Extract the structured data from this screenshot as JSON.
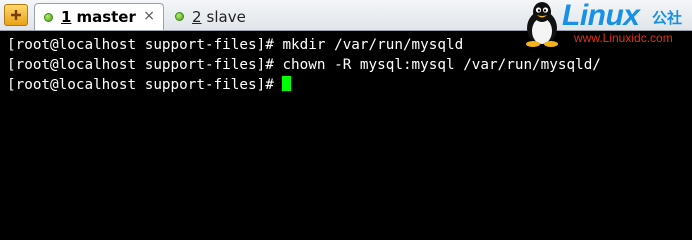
{
  "tabs": [
    {
      "number": "1",
      "title": "master",
      "close": "×",
      "active": true
    },
    {
      "number": "2",
      "title": "slave",
      "active": false
    }
  ],
  "logo": {
    "word": "Linux",
    "cn": "公社",
    "url": "www.Linuxidc.com"
  },
  "terminal": {
    "lines": [
      "[root@localhost support-files]# mkdir /var/run/mysqld",
      "[root@localhost support-files]# chown -R mysql:mysql /var/run/mysqld/",
      "[root@localhost support-files]# "
    ],
    "cursor_color": "#00ff00"
  },
  "colors": {
    "accent": "#1890e6",
    "url": "#e53010",
    "status_dot": "#49a01a"
  }
}
